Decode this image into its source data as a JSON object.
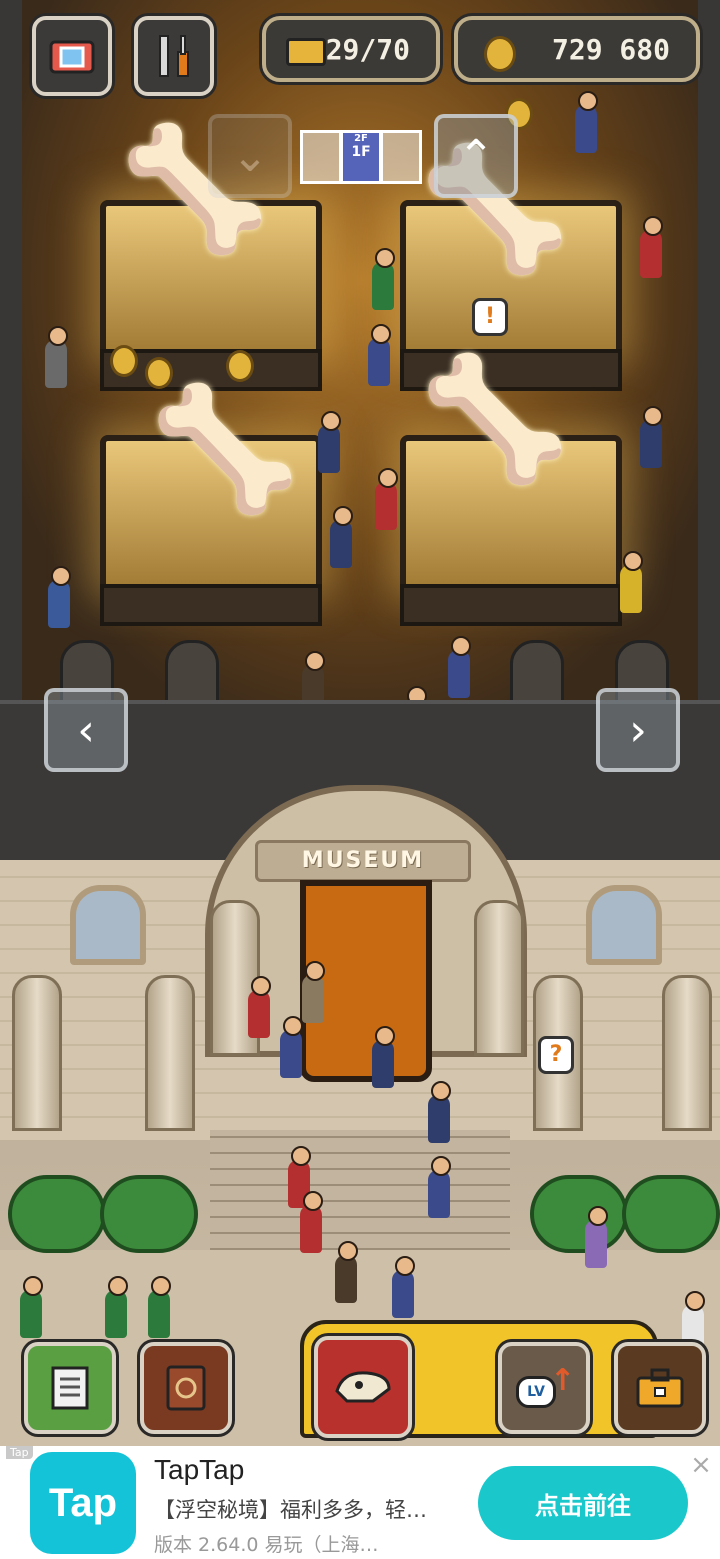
{
  "hud": {
    "visitor_count": "29/70",
    "coin_count": "729 680",
    "floor_label": "1F",
    "floor_label_upper": "2F",
    "camera_icon": "camera-icon",
    "tools_icon": "tools-icon"
  },
  "museum": {
    "sign_text": "MUSEUM"
  },
  "bubbles": {
    "alert": "!",
    "question": "?"
  },
  "bottom_bar": {
    "memo_icon": "memo-icon",
    "book_icon": "book-icon",
    "fossil_icon": "fossil-icon",
    "levelup_label": "LV",
    "briefcase_icon": "briefcase-icon"
  },
  "ad": {
    "tag": "Tap",
    "logo_text": "Tap",
    "title": "TapTap",
    "subtitle": "【浮空秘境】福利多多，轻…",
    "version": "版本 2.64.0   易玩（上海…",
    "cta": "点击前往",
    "close": "×"
  },
  "colors": {
    "accent_teal": "#1ac8cc",
    "tray_yellow": "#f1c42a",
    "hud_dark": "#3c3a37"
  }
}
